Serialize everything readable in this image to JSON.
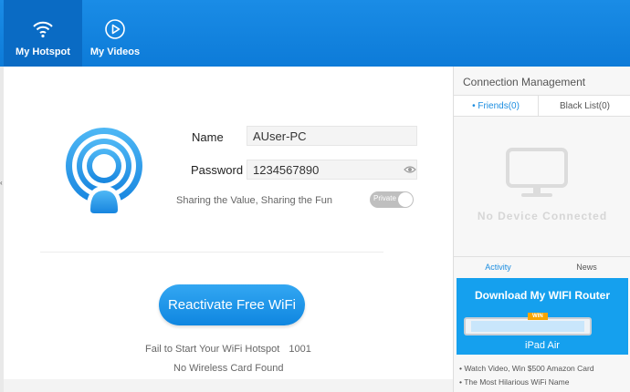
{
  "nav": {
    "tabs": [
      {
        "label": "My Hotspot",
        "icon": "wifi-icon",
        "active": true
      },
      {
        "label": "My Videos",
        "icon": "play-icon",
        "active": false
      }
    ]
  },
  "hotspot": {
    "name_label": "Name",
    "name_value": "AUser-PC",
    "password_label": "Password",
    "password_value": "1234567890",
    "share_text": "Sharing the Value, Sharing the Fun",
    "toggle_label": "Private",
    "toggle_on": true,
    "reactivate_label": "Reactivate Free WiFi",
    "error_text": "Fail to Start Your WiFi Hotspot",
    "error_code": "1001",
    "error_detail": "No Wireless Card Found"
  },
  "connection": {
    "title": "Connection Management",
    "friends_tab": "Friends(0)",
    "blacklist_tab": "Black List(0)",
    "empty_text": "No Device Connected"
  },
  "feed": {
    "activity_tab": "Activity",
    "news_tab": "News",
    "ad_title": "Download My WIFI Router",
    "ad_badge": "WIN",
    "ad_prize": "iPad Air",
    "items": [
      "Watch Video, Win $500 Amazon Card",
      "The Most Hilarious WiFi Name"
    ]
  },
  "colors": {
    "accent": "#1b8de0",
    "topbar": "#1a8ce6",
    "active_tab": "#0a6bc4"
  }
}
